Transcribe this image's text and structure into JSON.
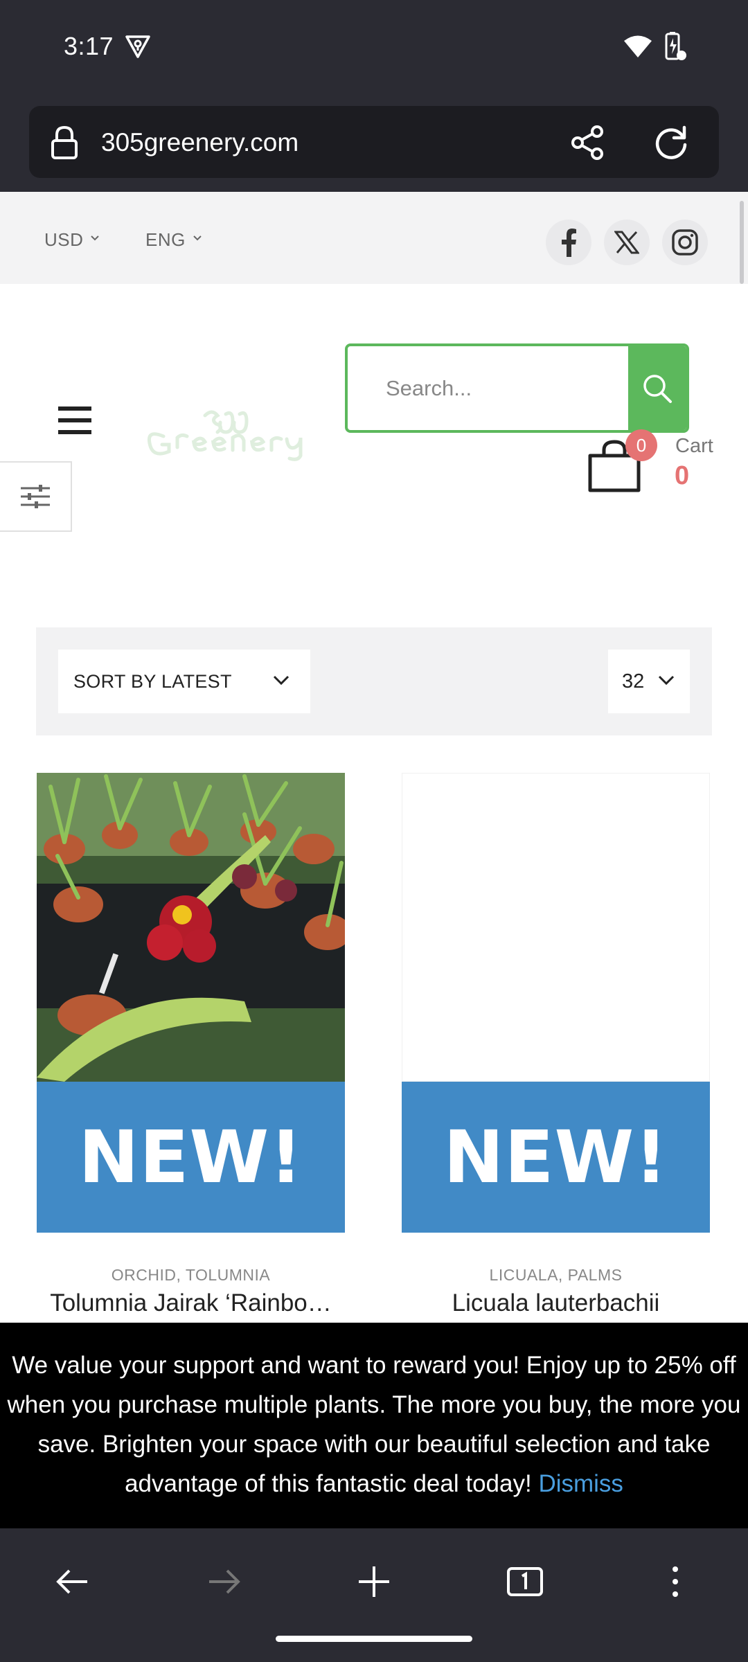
{
  "status_bar": {
    "time": "3:17",
    "vpn_icon": "vpn-key-icon",
    "wifi_icon": "wifi-icon",
    "battery_icon": "battery-charging-icon"
  },
  "browser": {
    "url": "305greenery.com",
    "share_icon": "share-icon",
    "reload_icon": "reload-icon"
  },
  "utility_bar": {
    "currency": "USD",
    "language": "ENG",
    "social": [
      "facebook-icon",
      "x-icon",
      "instagram-icon"
    ]
  },
  "header": {
    "search_placeholder": "Search...",
    "cart_label": "Cart",
    "cart_count": "0",
    "cart_total": "0"
  },
  "shop": {
    "sort_label": "SORT BY LATEST",
    "per_page": "32"
  },
  "products": [
    {
      "badge": "NEW!",
      "categories": "ORCHID, TOLUMNIA",
      "title": "Tolumnia Jairak ‘Rainbo…"
    },
    {
      "badge": "NEW!",
      "categories": "LICUALA, PALMS",
      "title": "Licuala lauterbachii"
    }
  ],
  "promo": {
    "text": "We value your support and want to reward you! Enjoy up to 25% off when you purchase multiple plants. The more you buy, the more you save. Brighten your space with our beautiful selection and take advantage of this fantastic deal today!",
    "dismiss": "Dismiss"
  },
  "colors": {
    "accent_green": "#5cb85c",
    "badge_red": "#e57373",
    "new_blue": "#418ac6",
    "link_blue": "#4a9fe0"
  }
}
